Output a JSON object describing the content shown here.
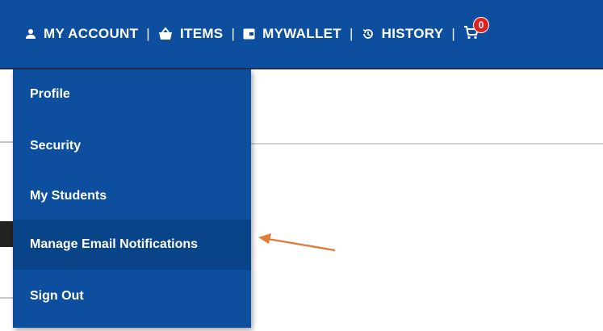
{
  "nav": {
    "account_label": "MY ACCOUNT",
    "items_label": "ITEMS",
    "wallet_label": "MYWALLET",
    "history_label": "HISTORY",
    "separator": "|",
    "cart_count": "0"
  },
  "dropdown": {
    "items": [
      {
        "label": "Profile"
      },
      {
        "label": "Security"
      },
      {
        "label": "My Students"
      },
      {
        "label": "Manage Email Notifications"
      },
      {
        "label": "Sign Out"
      }
    ]
  },
  "colors": {
    "header_bg": "#0d4f9e",
    "menu_bg": "#0d4f9e",
    "badge": "#e0201f",
    "arrow": "#e07b39"
  },
  "icons": [
    "user-icon",
    "basket-icon",
    "wallet-icon",
    "history-icon",
    "cart-icon",
    "arrow-icon"
  ]
}
